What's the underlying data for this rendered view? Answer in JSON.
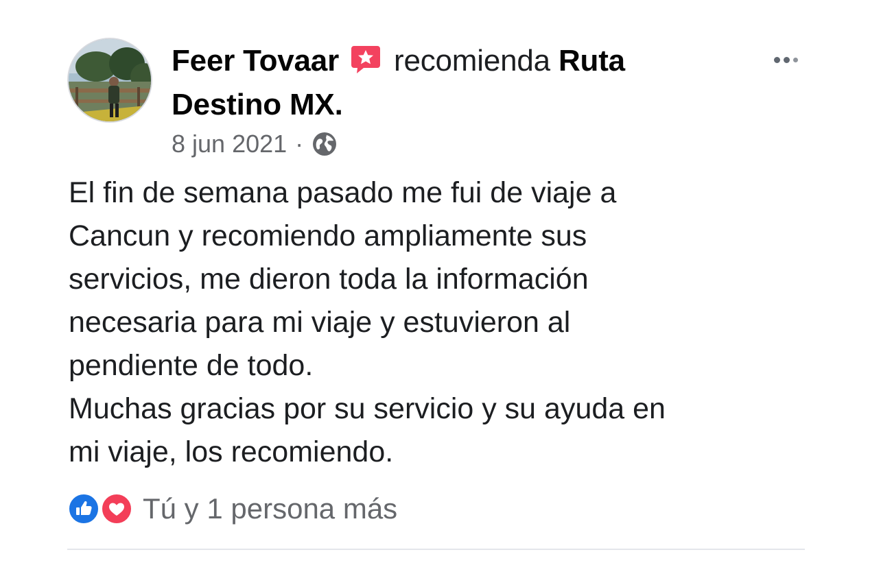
{
  "post": {
    "author": "Feer Tovaar",
    "action": "recomienda",
    "page_line1": "Ruta",
    "page_line2": "Destino MX.",
    "date": "8 jun 2021",
    "separator": "·",
    "privacy_icon": "globe-icon",
    "badge_icon": "recommendation-star-icon",
    "menu_icon": "more-options-icon",
    "body_lines": [
      "El fin de semana pasado me fui de viaje a",
      "Cancun y recomiendo ampliamente sus",
      "servicios, me dieron toda la información",
      "necesaria para mi viaje y estuvieron al",
      "pendiente de todo.",
      "Muchas gracias por su servicio y su ayuda en",
      "mi viaje, los recomiendo."
    ]
  },
  "reactions": {
    "icons": [
      "like-icon",
      "love-icon"
    ],
    "summary": "Tú y 1 persona más"
  },
  "colors": {
    "like_blue": "#1b74e4",
    "love_red": "#f33e58",
    "badge_pink": "#f3425f",
    "secondary_text": "#65676b"
  }
}
